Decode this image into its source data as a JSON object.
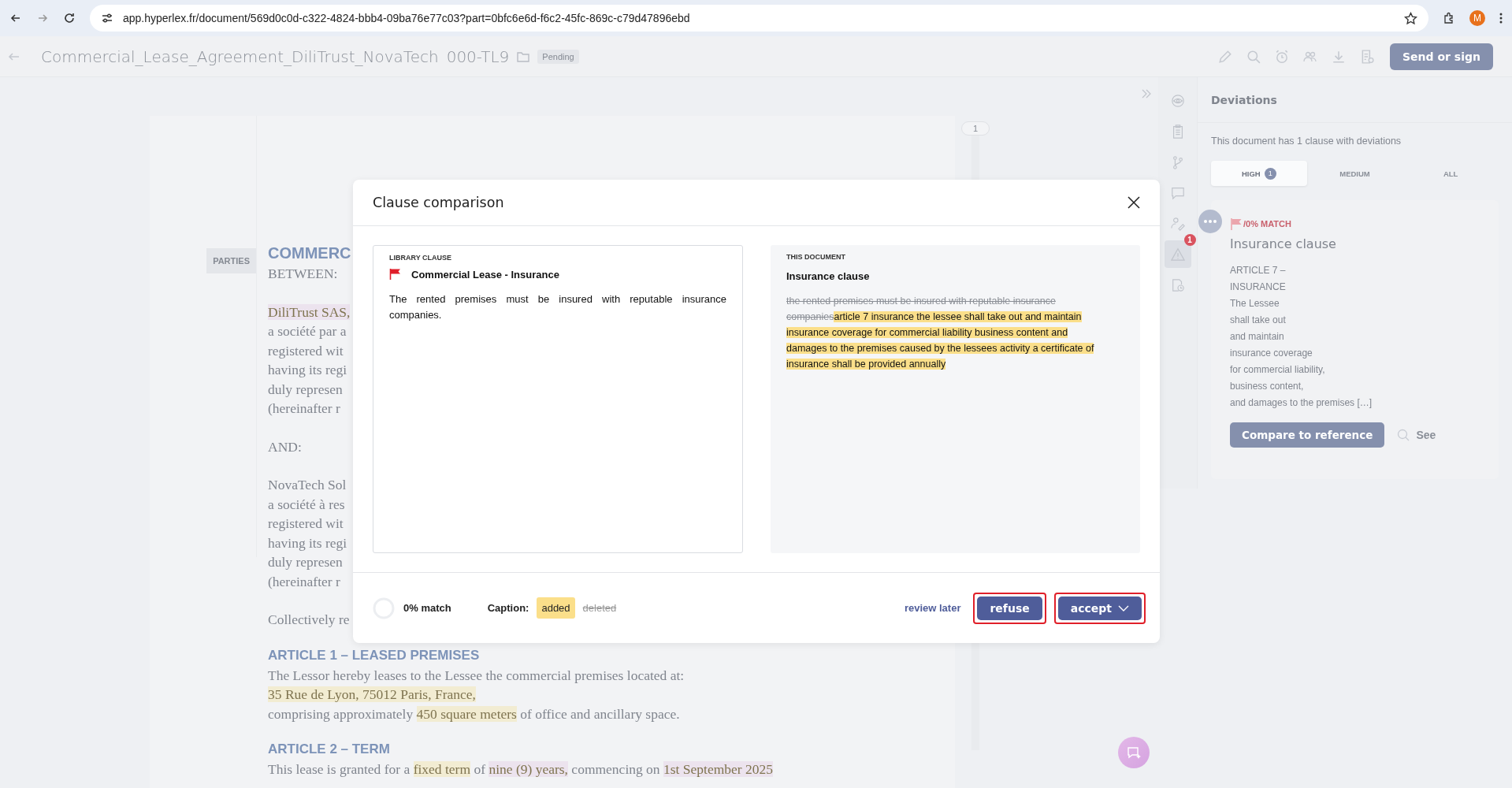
{
  "browser": {
    "url": "app.hyperlex.fr/document/569d0c0d-c322-4824-bbb4-09ba76e77c03?part=0bfc6e6d-f6c2-45fc-869c-c79d47896ebd",
    "profile": "M"
  },
  "header": {
    "title": "Commercial_Lease_Agreement_DiliTrust_NovaTech",
    "code": "000-TL9",
    "status": "Pending",
    "send_button": "Send or sign"
  },
  "document": {
    "section_tab": "PARTIES",
    "page_number": "1",
    "blocks": [
      {
        "kind": "title",
        "lines": [
          [
            {
              "text": "COMMERC"
            }
          ]
        ]
      },
      {
        "kind": "paragraph",
        "lines": [
          [
            {
              "text": "BETWEEN:"
            }
          ]
        ]
      },
      {
        "kind": "paragraph",
        "lines": [
          [
            {
              "text": "DiliTrust SAS,",
              "color": "#ece3ee"
            }
          ],
          [
            {
              "text": "a société par a"
            }
          ],
          [
            {
              "text": "registered wit"
            }
          ],
          [
            {
              "text": "having its regi"
            }
          ],
          [
            {
              "text": "duly represen"
            }
          ],
          [
            {
              "text": "(hereinafter r"
            }
          ]
        ]
      },
      {
        "kind": "paragraph",
        "lines": [
          [
            {
              "text": "AND:"
            }
          ]
        ]
      },
      {
        "kind": "paragraph",
        "lines": [
          [
            {
              "text": "NovaTech Sol"
            }
          ],
          [
            {
              "text": "a société à res"
            }
          ],
          [
            {
              "text": "registered wit"
            }
          ],
          [
            {
              "text": "having its regi"
            }
          ],
          [
            {
              "text": "duly represen"
            }
          ],
          [
            {
              "text": "(hereinafter r"
            }
          ]
        ]
      },
      {
        "kind": "paragraph",
        "lines": [
          [
            {
              "text": "Collectively re"
            }
          ]
        ]
      },
      {
        "kind": "heading",
        "lines": [
          [
            {
              "text": "ARTICLE 1 – LEASED PREMISES"
            }
          ]
        ]
      },
      {
        "kind": "paragraph",
        "lines": [
          [
            {
              "text": "The Lessor hereby leases to the Lessee the commercial premises located at:"
            }
          ],
          [
            {
              "text": "35 Rue de Lyon, 75012 Paris, France,",
              "color": "#f2ecd2"
            }
          ],
          [
            {
              "text": "comprising approximately "
            },
            {
              "text": "450 square meters",
              "color": "#f2ecd2"
            },
            {
              "text": " of office and ancillary space."
            }
          ]
        ]
      },
      {
        "kind": "heading",
        "lines": [
          [
            {
              "text": "ARTICLE 2 – TERM"
            }
          ]
        ]
      },
      {
        "kind": "paragraph",
        "lines": [
          [
            {
              "text": "This lease is granted for a "
            },
            {
              "text": "fixed term",
              "color": "#f2ecd2"
            },
            {
              "text": " of "
            },
            {
              "text": "nine (9) years,",
              "color": "#ece3ee"
            },
            {
              "text": " commencing on "
            },
            {
              "text": "1st September 2025",
              "color": "#ece3ee"
            }
          ]
        ]
      }
    ]
  },
  "rail": {
    "items": [
      {
        "kind": "eye",
        "selected": false
      },
      {
        "kind": "clipboard",
        "selected": false
      },
      {
        "kind": "branch",
        "selected": false
      },
      {
        "kind": "comment",
        "selected": false
      },
      {
        "kind": "signer",
        "selected": false
      },
      {
        "kind": "warning",
        "selected": true,
        "badge": "1"
      },
      {
        "kind": "history",
        "selected": false
      }
    ]
  },
  "deviations": {
    "title": "Deviations",
    "summary": "This document has 1 clause with deviations",
    "tabs": [
      {
        "label": "HIGH",
        "count": "1",
        "selected": true
      },
      {
        "label": "MEDIUM",
        "selected": false
      },
      {
        "label": "ALL",
        "selected": false
      }
    ],
    "card": {
      "match": "/0% MATCH",
      "title": "Insurance clause",
      "lines": [
        "ARTICLE 7 –",
        "INSURANCE",
        "The Lessee",
        "shall take out",
        "and maintain",
        "insurance coverage",
        "for commercial liability,",
        "business content,",
        "and damages to the premises  […]"
      ],
      "compare_button": "Compare to reference",
      "see_link": "See"
    }
  },
  "modal": {
    "title": "Clause comparison",
    "library": {
      "label": "LIBRARY CLAUSE",
      "title": "Commercial Lease - Insurance",
      "text": "The rented premises must be insured with reputable insurance companies."
    },
    "current": {
      "label": "THIS DOCUMENT",
      "title": "Insurance clause",
      "segments": [
        {
          "kind": "deleted",
          "text": "the rented premises must be insured with reputable insurance companies"
        },
        {
          "kind": "added",
          "text": "article 7  insurance the lessee shall take out and maintain insurance coverage for commercial liability business content and damages to the premises caused by the lessees activity a certificate of insurance shall be provided annually"
        }
      ]
    },
    "match": {
      "level": 0,
      "text": "0% match"
    },
    "caption": {
      "label": "Caption:",
      "items": [
        {
          "kind": "added",
          "text": "added"
        },
        {
          "kind": "deleted",
          "text": "deleted"
        }
      ]
    },
    "review_link": "review later",
    "buttons": [
      {
        "kind": "refuse",
        "label": "refuse",
        "outlined": true
      },
      {
        "kind": "accept",
        "label": "accept",
        "outlined": true
      }
    ]
  }
}
